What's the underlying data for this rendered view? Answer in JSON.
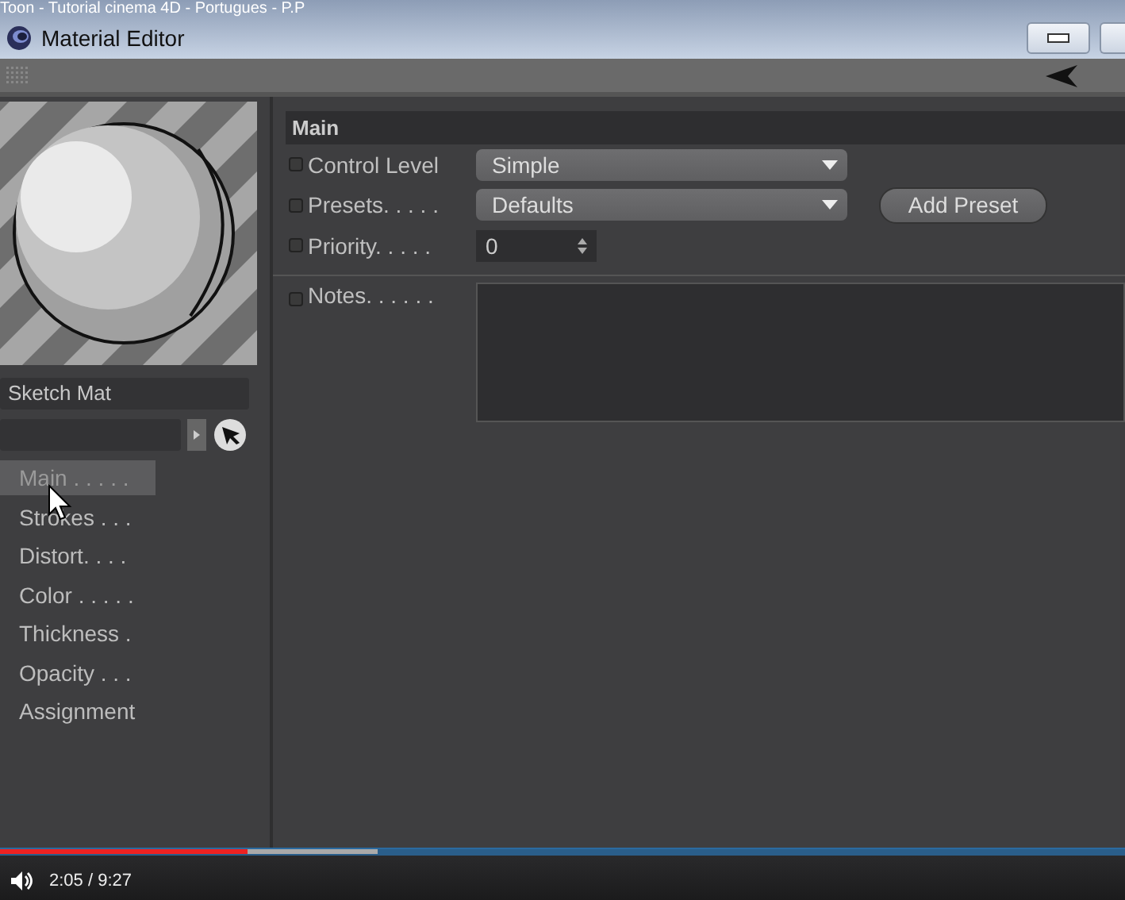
{
  "video_title": "Toon - Tutorial cinema 4D - Portugues - P.P",
  "window": {
    "title": "Material Editor"
  },
  "material": {
    "name": "Sketch Mat"
  },
  "channels": [
    {
      "label": "Main . . . . .",
      "selected": true
    },
    {
      "label": "Strokes . . .",
      "selected": false
    },
    {
      "label": "Distort. . . .",
      "selected": false
    },
    {
      "label": "Color . . . . .",
      "selected": false
    },
    {
      "label": "Thickness  .",
      "selected": false
    },
    {
      "label": "Opacity . . .",
      "selected": false
    },
    {
      "label": "Assignment",
      "selected": false
    }
  ],
  "section": {
    "title": "Main"
  },
  "fields": [
    {
      "kind": "dropdown",
      "label": "Control Level",
      "value": "Simple"
    },
    {
      "kind": "dropdown",
      "label": "Presets. . . . .",
      "value": "Defaults",
      "button": "Add Preset"
    },
    {
      "kind": "spinner",
      "label": "Priority. . . . .",
      "value": "0"
    },
    {
      "kind": "textarea",
      "label": "Notes. . . . . ."
    }
  ],
  "player": {
    "progress": {
      "level": 0.22
    },
    "buffer": {
      "level": 0.335
    },
    "time": "2:05 / 9:27"
  }
}
